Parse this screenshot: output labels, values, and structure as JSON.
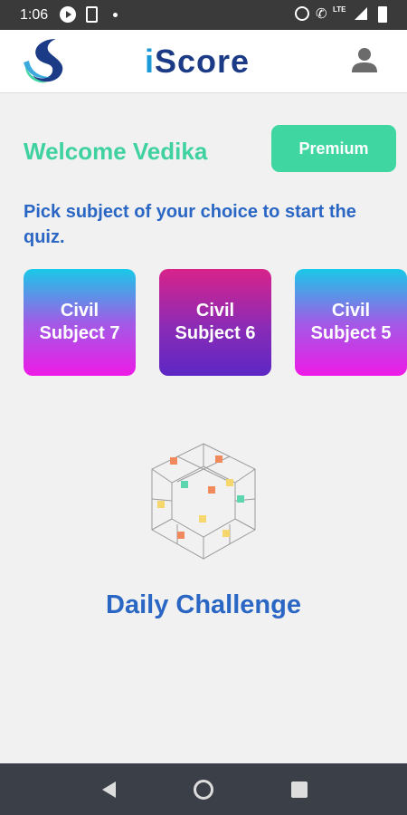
{
  "status_bar": {
    "time": "1:06",
    "network_label": "LTE",
    "icons": [
      "play-icon",
      "phone-icon",
      "dot-icon",
      "alarm-icon",
      "call-icon",
      "signal-icon",
      "battery-icon"
    ]
  },
  "header": {
    "title_prefix": "i",
    "title_rest": "Score",
    "logo_icon": "iscore-logo",
    "profile_icon": "person-icon",
    "title_color": "#1c3b86",
    "accent_color": "#1a9ad6"
  },
  "welcome": {
    "text": "Welcome Vedika",
    "premium_label": "Premium",
    "premium_color": "#3fd6a2",
    "text_color": "#3fd2a0"
  },
  "instruction": "Pick subject of your choice to start the quiz.",
  "subjects": [
    {
      "label": "Civil Subject 7"
    },
    {
      "label": "Civil Subject 6"
    },
    {
      "label": "Civil Subject 5"
    }
  ],
  "daily_challenge": {
    "label": "Daily Challenge",
    "icon": "cube-grid-icon"
  },
  "nav_bar": {
    "icons": [
      "back-icon",
      "home-icon",
      "recent-apps-icon"
    ]
  }
}
